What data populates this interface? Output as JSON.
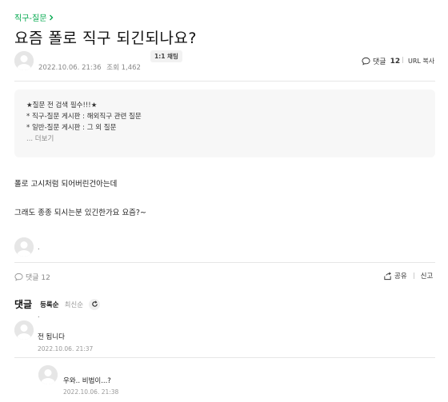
{
  "breadcrumb": {
    "label": "직구-질문"
  },
  "post": {
    "title": "요즘 폴로 직구 되긴되나요?",
    "date": "2022.10.06. 21:36",
    "views_label": "조회 1,462",
    "chat_badge": "1:1 채팅",
    "comment_label": "댓글",
    "comment_count": "12",
    "url_copy": "URL 복사",
    "body_line1": "폴로 고시처럼 되어버린건아는데",
    "body_line2": "그래도 종종 되시는분 있긴한가요 요즘?~"
  },
  "notice": {
    "line1": "★질문 전 검색 필수!!!★",
    "line2": "* 직구-질문 게시판 : 해외직구 관련 질문",
    "line3": "* 일반-질문 게시판 : 그 외 질문",
    "more": "... 더보기"
  },
  "author_nick": ".",
  "footer": {
    "comment_label": "댓글 12",
    "share": "공유",
    "report": "신고"
  },
  "comments_section": {
    "title": "댓글",
    "sort_registered": "등록순",
    "sort_latest": "최신순"
  },
  "comments": [
    {
      "nick": ".",
      "text": "전 됩니다",
      "date": "2022.10.06. 21:37"
    },
    {
      "nick": "",
      "text": "우와.. 비법이...?",
      "date": "2022.10.06. 21:38"
    }
  ],
  "colors": {
    "accent": "#03a84e"
  },
  "icons": [
    "chevron-right-icon",
    "chat-bubble-icon",
    "share-icon",
    "refresh-icon",
    "avatar-icon"
  ]
}
